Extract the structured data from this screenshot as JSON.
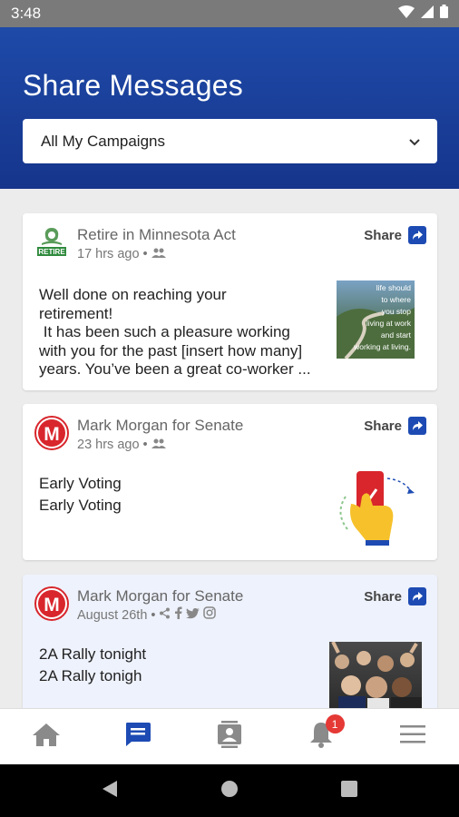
{
  "status": {
    "time": "3:48"
  },
  "header": {
    "title": "Share Messages",
    "filter_value": "All My Campaigns"
  },
  "cards": [
    {
      "org": "Retire in Minnesota Act",
      "time": "17 hrs ago",
      "share_label": "Share",
      "avatar_text": "RETIRE",
      "lines": [
        "Well done on reaching your",
        "retirement!",
        " It has been such a pleasure working",
        "with you for the past [insert how many]",
        "years. You’ve been a great co-worker ..."
      ],
      "thumb_lines": [
        "life should",
        "to where",
        "you stop",
        "living at work",
        "and start",
        "working at living."
      ]
    },
    {
      "org": "Mark Morgan for Senate",
      "time": "23 hrs ago",
      "share_label": "Share",
      "avatar_text": "M",
      "lines": [
        "Early Voting",
        "Early Voting"
      ]
    },
    {
      "org": "Mark Morgan for Senate",
      "time": "August 26th",
      "share_label": "Share",
      "avatar_text": "M",
      "lines": [
        "2A Rally tonight",
        "2A Rally tonigh"
      ]
    }
  ],
  "nav": {
    "notification_count": "1"
  },
  "colors": {
    "brand_blue": "#1e4aa8",
    "badge_red": "#e53935",
    "status_bar": "#7a7a7a"
  }
}
